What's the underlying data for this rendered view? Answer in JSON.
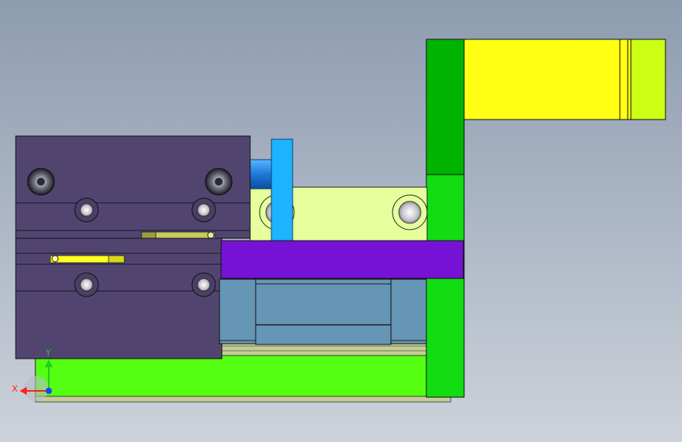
{
  "view": {
    "background_top": "#8e9cb0",
    "background_bottom": "#cdd2da"
  },
  "parts": {
    "cylinder_body": "#514570",
    "guide_block_cyan": "#1fb3ff",
    "piston_rod": "#2a8ee0",
    "link_plate": "#e6ff9c",
    "purple_plate": "#7612d6",
    "slider_block": "#6596b6",
    "rail_stack": "#c5cf90",
    "green_base": "#55ff12",
    "dark_green_bracket": "#00b300",
    "light_green_bracket": "#12dd12",
    "yellow_arm": "#ffff14",
    "yellow_green_tip": "#ccff14",
    "slot_yellow": "#ffff22"
  },
  "triad": {
    "x_label": "X",
    "y_label": "Y",
    "x_color": "#ff2020",
    "y_color": "#22cc22",
    "z_color": "#2040ff"
  }
}
